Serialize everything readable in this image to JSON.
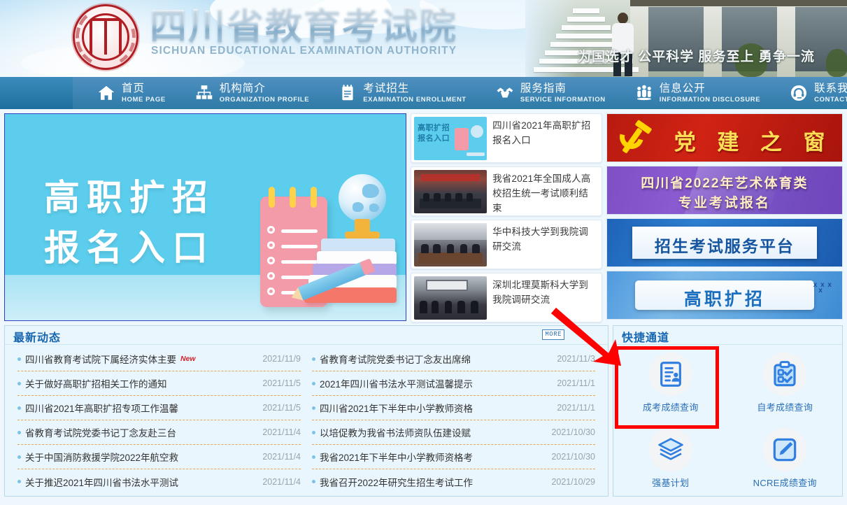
{
  "site": {
    "title_zh": "四川省教育考试院",
    "title_en": "SICHUAN EDUCATIONAL EXAMINATION AUTHORITY",
    "slogan": "为国选才 公平科学 服务至上 勇争一流",
    "logo_icon": "sichuan-seal-logo-icon"
  },
  "nav": {
    "items": [
      {
        "zh": "首页",
        "en": "HOME  PAGE",
        "icon": "home-icon"
      },
      {
        "zh": "机构简介",
        "en": "ORGANIZATION PROFILE",
        "icon": "org-chart-icon"
      },
      {
        "zh": "考试招生",
        "en": "EXAMINATION ENROLLMENT",
        "icon": "notebook-icon"
      },
      {
        "zh": "服务指南",
        "en": "SERVICE  INFORMATION",
        "icon": "handshake-icon"
      },
      {
        "zh": "信息公开",
        "en": "INFORMATION  DISCLOSURE",
        "icon": "people-group-icon"
      },
      {
        "zh": "联系我们",
        "en": "CONTACT  US",
        "icon": "headset-icon"
      }
    ]
  },
  "banner": {
    "line1": "高职扩招",
    "line2": "报名入口",
    "illustration": "notebook-globe-books-pencil-illustration"
  },
  "news_cards": [
    {
      "title": "四川省2021年高职扩招报名入口",
      "thumb": "promo-gaozhi-kuozhao-thumb"
    },
    {
      "title": "我省2021年全国成人高校招生统一考试顺利结束",
      "thumb": "meeting-room-red-banner-photo"
    },
    {
      "title": "华中科技大学到我院调研交流",
      "thumb": "conference-room-photo"
    },
    {
      "title": "深圳北理莫斯科大学到我院调研交流",
      "thumb": "conference-room-screen-photo"
    }
  ],
  "side_banners": [
    {
      "text": "党 建 之 窗",
      "icon": "hammer-sickle-icon",
      "color": "#c81f12"
    },
    {
      "line1": "四川省2022年艺术体育类",
      "line2": "专业考试报名",
      "color": "#7f4fc4"
    },
    {
      "text": "招生考试服务平台",
      "color": "#2570c4"
    },
    {
      "text": "高职扩招",
      "color": "#63a9e2"
    }
  ],
  "news_panel": {
    "title": "最新动态",
    "more_label": "MORE",
    "left_column": [
      {
        "title": "四川省教育考试院下属经济实体主要",
        "badge": "New",
        "date": "2021/11/9"
      },
      {
        "title": "关于做好高职扩招相关工作的通知",
        "badge": "",
        "date": "2021/11/5"
      },
      {
        "title": "四川省2021年高职扩招专项工作温馨",
        "badge": "",
        "date": "2021/11/5"
      },
      {
        "title": "省教育考试院党委书记丁念友赴三台",
        "badge": "",
        "date": "2021/11/4"
      },
      {
        "title": "关于中国消防救援学院2022年航空救",
        "badge": "",
        "date": "2021/11/4"
      },
      {
        "title": "关于推迟2021年四川省书法水平测试",
        "badge": "",
        "date": "2021/11/4"
      }
    ],
    "right_column": [
      {
        "title": "省教育考试院党委书记丁念友出席绵",
        "badge": "",
        "date": "2021/11/3"
      },
      {
        "title": "2021年四川省书法水平测试温馨提示",
        "badge": "",
        "date": "2021/11/1"
      },
      {
        "title": "四川省2021年下半年中小学教师资格",
        "badge": "",
        "date": "2021/11/1"
      },
      {
        "title": "以培促教为我省书法师资队伍建设赋",
        "badge": "",
        "date": "2021/10/30"
      },
      {
        "title": "我省2021年下半年中小学教师资格考",
        "badge": "",
        "date": "2021/10/30"
      },
      {
        "title": "我省召开2022年研究生招生考试工作",
        "badge": "",
        "date": "2021/10/29"
      }
    ]
  },
  "quick_panel": {
    "title": "快捷通道",
    "items": [
      {
        "label": "成考成绩查询",
        "icon": "document-person-icon",
        "highlighted": true
      },
      {
        "label": "自考成绩查询",
        "icon": "clipboard-check-icon",
        "highlighted": false
      },
      {
        "label": "强基计划",
        "icon": "stacked-layers-icon",
        "highlighted": false
      },
      {
        "label": "NCRE成绩查询",
        "icon": "pencil-square-icon",
        "highlighted": false
      }
    ]
  },
  "annotations": {
    "highlight_color": "#ff0000",
    "arrow": "red-pointer-arrow"
  }
}
